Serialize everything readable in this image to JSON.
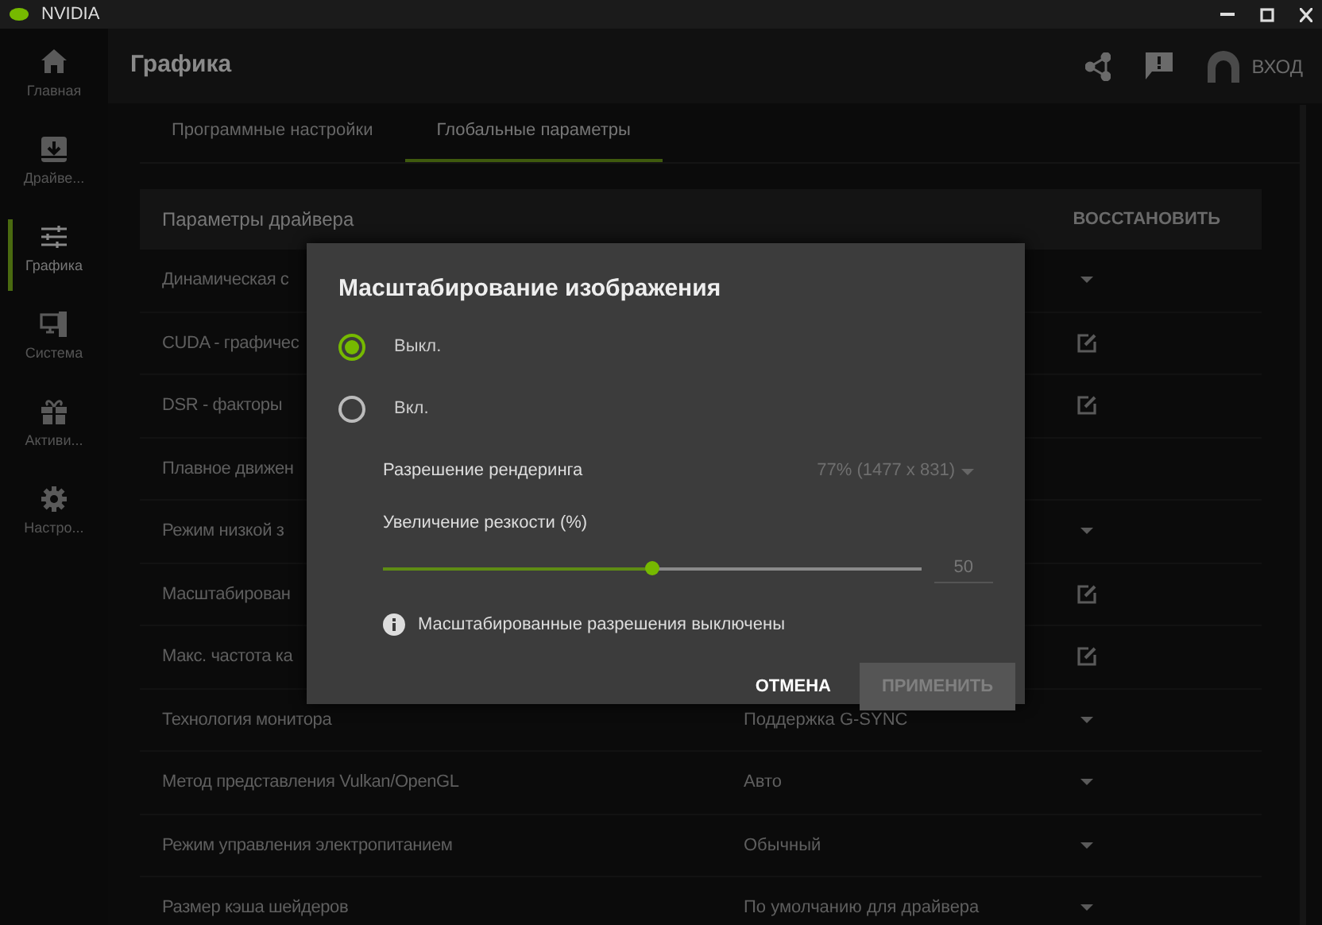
{
  "window": {
    "title": "NVIDIA"
  },
  "sidebar": {
    "items": [
      {
        "label": "Главная",
        "kind": "home",
        "selected": false
      },
      {
        "label": "Драйве...",
        "kind": "download",
        "selected": false
      },
      {
        "label": "Графика",
        "kind": "sliders",
        "selected": true
      },
      {
        "label": "Система",
        "kind": "system",
        "selected": false
      },
      {
        "label": "Активи...",
        "kind": "gift",
        "selected": false
      },
      {
        "label": "Настро...",
        "kind": "gear",
        "selected": false
      }
    ]
  },
  "header": {
    "title": "Графика",
    "login": "ВХОД"
  },
  "tabs": [
    {
      "label": "Программные настройки",
      "selected": false
    },
    {
      "label": "Глобальные параметры",
      "selected": true
    }
  ],
  "section": {
    "title": "Параметры драйвера",
    "restore": "ВОССТАНОВИТЬ"
  },
  "rows": [
    {
      "label": "Динамическая с",
      "kind": "dropdown"
    },
    {
      "label": "CUDA - графичес",
      "kind": "edit"
    },
    {
      "label": "DSR - факторы",
      "kind": "edit"
    },
    {
      "label": "Плавное движен",
      "kind": "none"
    },
    {
      "label": "Режим низкой з",
      "kind": "dropdown"
    },
    {
      "label": "Масштабирован",
      "kind": "edit"
    },
    {
      "label": "Макс. частота ка",
      "kind": "edit"
    },
    {
      "label": "Технология монитора",
      "value": "Поддержка G-SYNC",
      "kind": "dropdown"
    },
    {
      "label": "Метод представления Vulkan/OpenGL",
      "value": "Авто",
      "kind": "dropdown"
    },
    {
      "label": "Режим управления электропитанием",
      "value": "Обычный",
      "kind": "dropdown"
    },
    {
      "label": "Размер кэша шейдеров",
      "value": "По умолчанию для драйвера",
      "kind": "dropdown"
    }
  ],
  "dialog": {
    "title": "Масштабирование изображения",
    "options": [
      {
        "label": "Выкл.",
        "selected": true
      },
      {
        "label": "Вкл.",
        "selected": false
      }
    ],
    "resolution": {
      "label": "Разрешение рендеринга",
      "value": "77% (1477 x 831)"
    },
    "sharpen": {
      "label": "Увеличение резкости (%)",
      "level": 0.5,
      "value": "50"
    },
    "info": "Масштабированные разрешения выключены",
    "cancel": {
      "label": "ОТМЕНА",
      "disabled": false
    },
    "apply": {
      "label": "ПРИМЕНИТЬ",
      "disabled": true
    }
  }
}
